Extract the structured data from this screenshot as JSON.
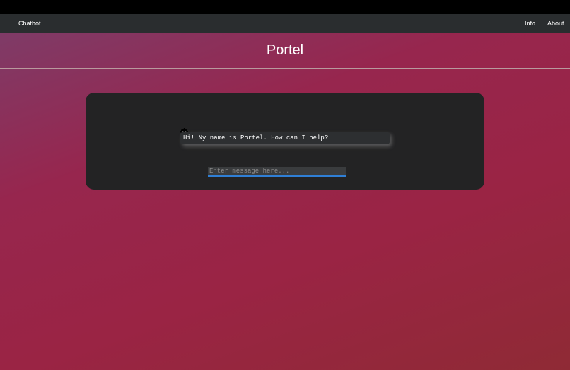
{
  "navbar": {
    "brand": "Chatbot",
    "links": [
      "Info",
      "About"
    ]
  },
  "page": {
    "title": "Portel"
  },
  "chat": {
    "messages": [
      {
        "sender": "bot",
        "icon": "robot-icon",
        "text": "Hi! Ny name is Portel. How can I help?"
      }
    ],
    "input": {
      "value": "",
      "placeholder": "Enter message here..."
    }
  },
  "colors": {
    "navbar_bg": "#2a2d2f",
    "panel_bg": "#232324",
    "input_underline": "#2f7fd6",
    "background_start": "#7a3f6c",
    "background_end": "#8f2a35"
  }
}
